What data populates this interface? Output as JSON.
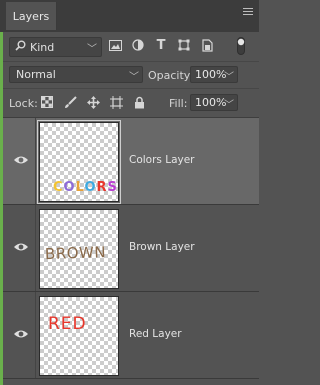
{
  "panel": {
    "tab_label": "Layers"
  },
  "filter": {
    "kind_label": "Kind",
    "icons": [
      "image-filter-icon",
      "adjustment-filter-icon",
      "type-filter-icon",
      "shape-filter-icon",
      "smart-object-filter-icon",
      "filter-toggle-icon"
    ]
  },
  "blend": {
    "mode": "Normal",
    "opacity_label": "Opacity:",
    "opacity_value": "100%"
  },
  "lock": {
    "label": "Lock:",
    "icons": [
      "lock-transparent-pixels-icon",
      "lock-image-pixels-icon",
      "lock-position-icon",
      "lock-artboard-icon",
      "lock-all-icon"
    ],
    "fill_label": "Fill:",
    "fill_value": "100%"
  },
  "layers": [
    {
      "name": "Colors Layer",
      "thumbnail_text": "COLORS",
      "selected": true,
      "visible": true
    },
    {
      "name": "Brown Layer",
      "thumbnail_text": "BROWN",
      "selected": false,
      "visible": true
    },
    {
      "name": "Red Layer",
      "thumbnail_text": "RED",
      "selected": false,
      "visible": true
    }
  ],
  "colors": {
    "panel_bg": "#535353",
    "selected_row": "#686868",
    "accent_strip": "#6ab04c",
    "brown_text": "#8a6a4a",
    "red_text": "#e8372c"
  }
}
